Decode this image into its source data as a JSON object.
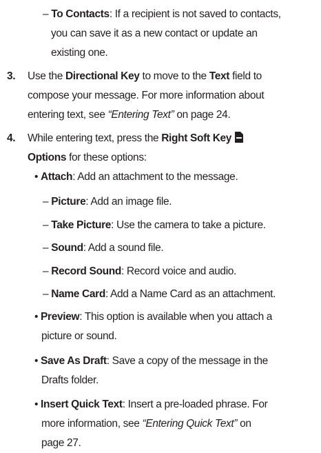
{
  "to_contacts": {
    "dash": "–",
    "term": "To Contacts",
    "l1": ": If a recipient is not saved to contacts,",
    "l2": "you can save it as a new contact or update an",
    "l3": "existing one."
  },
  "step3": {
    "number": "3.",
    "p1": "Use the ",
    "b1": "Directional Key",
    "p2": " to move to the ",
    "b2": "Text",
    "p3": " field to",
    "l2": "compose your message. For more information about",
    "l3a": "entering text, see ",
    "l3ref": "“Entering Text”",
    "l3b": " on page 24."
  },
  "step4": {
    "number": "4.",
    "p1": "While entering text, press the ",
    "b1": "Right Soft Key",
    "b2": "Options",
    "p2": " for these options:"
  },
  "attach": {
    "bullet": "•",
    "term": "Attach",
    "text": ": Add an attachment to the message."
  },
  "sub_items": [
    {
      "dash": "–",
      "term": "Picture",
      "text": ": Add an image file."
    },
    {
      "dash": "–",
      "term": "Take Picture",
      "text": ": Use the camera to take a picture."
    },
    {
      "dash": "–",
      "term": "Sound",
      "text": ": Add a sound file."
    },
    {
      "dash": "–",
      "term": "Record Sound",
      "text": ": Record voice and audio."
    },
    {
      "dash": "–",
      "term": "Name Card",
      "text": ": Add a Name Card as an attachment."
    }
  ],
  "preview": {
    "bullet": "•",
    "term": "Preview",
    "l1": ": This option is available when you attach a",
    "l2": "picture or sound."
  },
  "save_draft": {
    "bullet": "•",
    "term": "Save As Draft",
    "l1": ": Save a copy of the message in the",
    "l2": "Drafts folder."
  },
  "quick_text": {
    "bullet": "•",
    "term": "Insert Quick Text",
    "l1": ": Insert a pre-loaded phrase. For",
    "l2a": "more information, see ",
    "l2ref": "“Entering Quick Text”",
    "l2b": " on",
    "l3": "page 27."
  },
  "colors": {
    "text": "#231f20"
  },
  "icons": {
    "softkey": "right-soft-key-icon"
  }
}
